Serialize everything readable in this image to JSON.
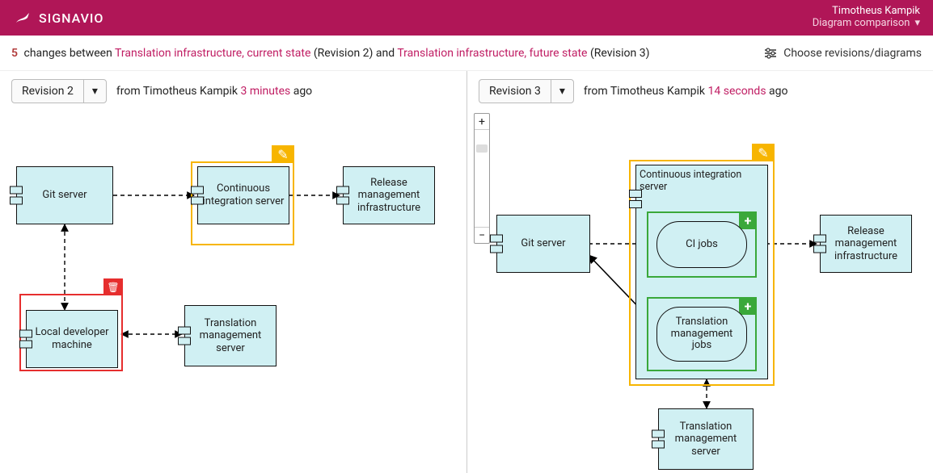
{
  "app": {
    "brand": "SIGNAVIO",
    "user": "Timotheus Kampik",
    "page": "Diagram comparison"
  },
  "subheader": {
    "change_count": "5",
    "changes_word": "changes between",
    "diagram_a": "Translation infrastructure, current state",
    "revision_a_paren": "(Revision 2)",
    "and_word": "and",
    "diagram_b": "Translation infrastructure, future state",
    "revision_b_paren": "(Revision 3)",
    "choose_label": "Choose revisions/diagrams"
  },
  "pane_left": {
    "revision_label": "Revision 2",
    "from_word": "from",
    "author": "Timotheus Kampik",
    "ago": "3 minutes",
    "ago_suffix": "ago",
    "nodes": {
      "git": "Git server",
      "ci": "Continuous integration server",
      "release": "Release management infrastructure",
      "local": "Local developer machine",
      "tms": "Translation management server"
    }
  },
  "pane_right": {
    "revision_label": "Revision 3",
    "from_word": "from",
    "author": "Timotheus Kampik",
    "ago": "14 seconds",
    "ago_suffix": "ago",
    "nodes": {
      "git": "Git server",
      "ci_container": "Continuous integration server",
      "ci_jobs": "CI jobs",
      "tr_jobs": "Translation management jobs",
      "release": "Release management infrastructure",
      "tms": "Translation management server"
    }
  },
  "icons": {
    "chevron_down": "▾",
    "plus": "+",
    "minus": "−",
    "sliders": "≡",
    "pencil": "✎",
    "trash": "🗑",
    "add": "+"
  }
}
